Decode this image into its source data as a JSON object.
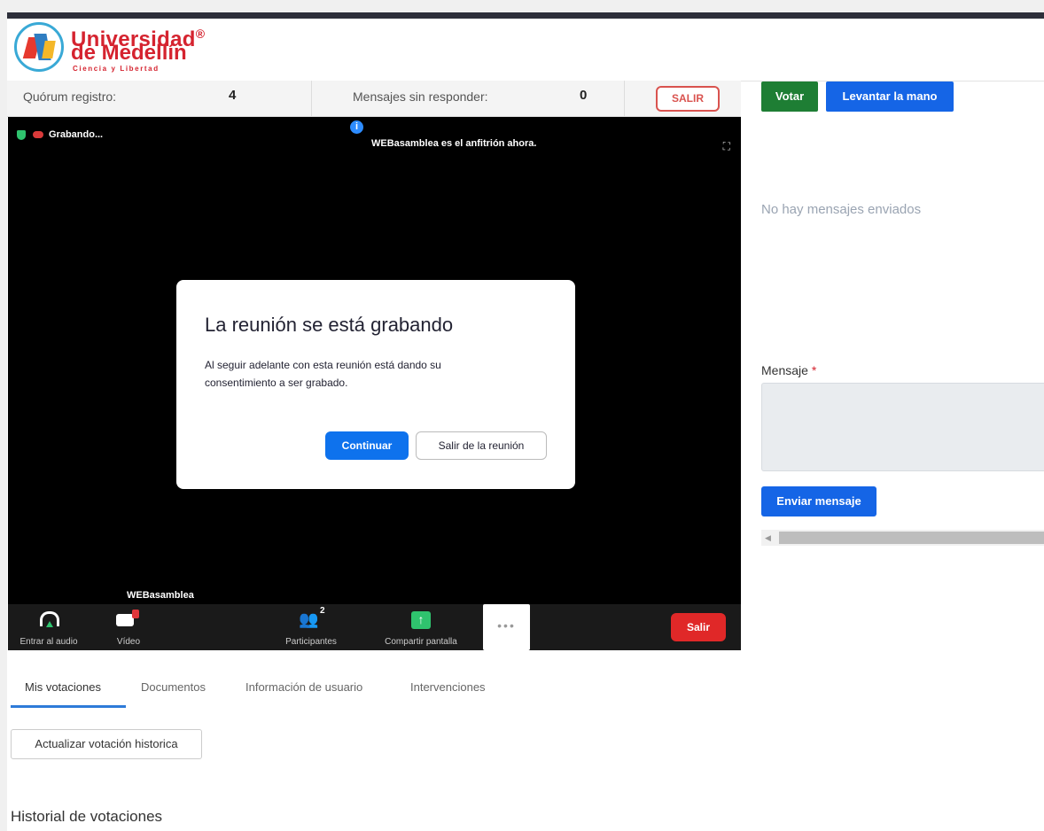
{
  "branding": {
    "name_line1": "Universidad",
    "reg_mark": "®",
    "name_line2": "de Medellín",
    "tagline": "Ciencia y Libertad"
  },
  "stats": {
    "quorum_label": "Quórum registro:",
    "quorum_value": "4",
    "unanswered_label": "Mensajes sin responder:",
    "unanswered_value": "0",
    "exit_label": "SALIR"
  },
  "meeting": {
    "recording_label": "Grabando...",
    "host_message": "WEBasamblea es el anfitrión ahora.",
    "participant_name": "WEBasamblea",
    "dialog": {
      "title": "La reunión se está grabando",
      "body": "Al seguir adelante con esta reunión está dando su consentimiento a ser grabado.",
      "continue_label": "Continuar",
      "leave_label": "Salir de la reunión"
    },
    "toolbar": {
      "audio_label": "Entrar al audio",
      "video_label": "Vídeo",
      "participants_label": "Participantes",
      "participants_count": "2",
      "share_label": "Compartir pantalla",
      "more_label": "•••",
      "leave_label": "Salir"
    }
  },
  "tabs": [
    {
      "label": "Mis votaciones",
      "active": true
    },
    {
      "label": "Documentos",
      "active": false
    },
    {
      "label": "Información de usuario",
      "active": false
    },
    {
      "label": "Intervenciones",
      "active": false
    }
  ],
  "votes": {
    "refresh_label": "Actualizar votación historica",
    "history_title": "Historial de votaciones"
  },
  "chat": {
    "vote_label": "Votar",
    "raise_hand_label": "Levantar la mano",
    "empty_message": "No hay mensajes enviados",
    "message_label": "Mensaje",
    "required_mark": "*",
    "send_label": "Enviar mensaje"
  },
  "colors": {
    "brand_red": "#d5232f",
    "accent_blue": "#1565e6",
    "vote_green": "#1e7e34",
    "zoom_blue": "#0e72ed",
    "leave_red": "#e02828"
  }
}
